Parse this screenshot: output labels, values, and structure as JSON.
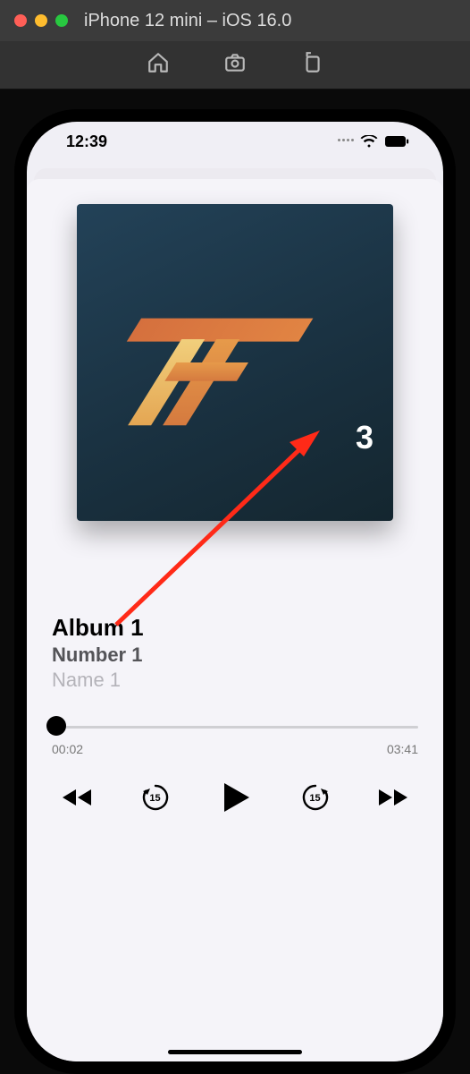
{
  "window": {
    "title": "iPhone 12 mini – iOS 16.0"
  },
  "status": {
    "time": "12:39"
  },
  "player": {
    "album": "Album 1",
    "track": "Number 1",
    "artist": "Name 1",
    "elapsed": "00:02",
    "duration": "03:41",
    "progress_pct": 1.2,
    "badge": "3",
    "skip_seconds": "15"
  }
}
